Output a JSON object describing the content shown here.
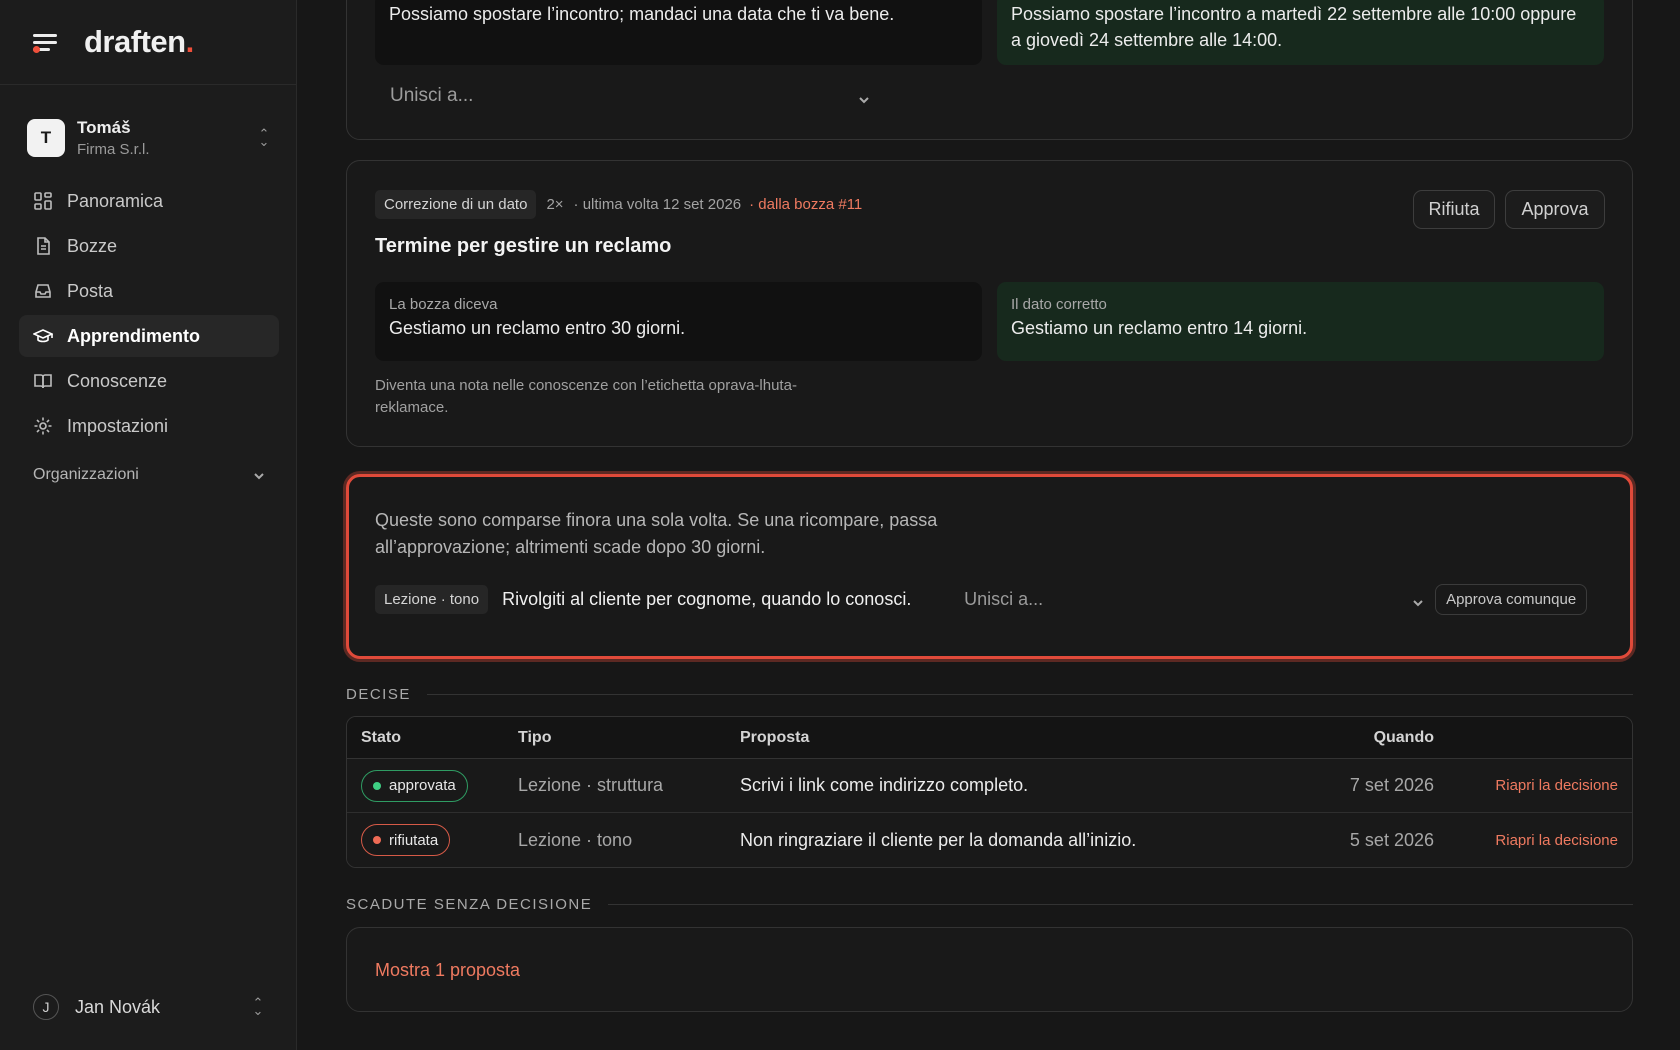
{
  "brand": {
    "name": "draften",
    "dot": "."
  },
  "workspace": {
    "initial": "T",
    "name": "Tomáš",
    "org": "Firma S.r.l."
  },
  "nav": [
    {
      "label": "Panoramica",
      "icon": "dashboard-icon"
    },
    {
      "label": "Bozze",
      "icon": "document-icon"
    },
    {
      "label": "Posta",
      "icon": "inbox-icon"
    },
    {
      "label": "Apprendimento",
      "icon": "graduation-cap-icon",
      "active": true
    },
    {
      "label": "Conoscenze",
      "icon": "book-icon"
    },
    {
      "label": "Impostazioni",
      "icon": "gear-icon"
    }
  ],
  "organizations": {
    "label": "Organizzazioni"
  },
  "user": {
    "initial": "J",
    "name": "Jan Novák"
  },
  "card_top": {
    "old_text": "Possiamo spostare l’incontro; mandaci una data che ti va bene.",
    "new_text": "Possiamo spostare l’incontro a martedì 22 settembre alle 10:00 oppure a giovedì 24 settembre alle 14:00.",
    "merge_placeholder": "Unisci a..."
  },
  "card_correction": {
    "tag": "Correzione di un dato",
    "count": "2×",
    "last": "· ultima volta 12 set 2026",
    "source": "· dalla bozza #11",
    "reject_label": "Rifiuta",
    "approve_label": "Approva",
    "title": "Termine per gestire un reclamo",
    "old_label": "La bozza diceva",
    "old_text": "Gestiamo un reclamo entro 30 giorni.",
    "new_label": "Il dato corretto",
    "new_text": "Gestiamo un reclamo entro 14 giorni.",
    "note": "Diventa una nota nelle conoscenze con l’etichetta oprava-lhuta-reklamace."
  },
  "card_single": {
    "intro": "Queste sono comparse finora una sola volta. Se una ricompare, passa all’approvazione; altrimenti scade dopo 30 giorni.",
    "tag": "Lezione · tono",
    "lesson": "Rivolgiti al cliente per cognome, quando lo conosci.",
    "merge_placeholder": "Unisci a...",
    "approve_anyway": "Approva comunque"
  },
  "decided": {
    "title": "DECISE",
    "headers": {
      "status": "Stato",
      "type": "Tipo",
      "proposal": "Proposta",
      "when": "Quando"
    },
    "rows": [
      {
        "status": "approvata",
        "type": "Lezione · struttura",
        "proposal": "Scrivi i link come indirizzo completo.",
        "when": "7 set 2026",
        "action": "Riapri la decisione"
      },
      {
        "status": "rifiutata",
        "type": "Lezione · tono",
        "proposal": "Non ringraziare il cliente per la domanda all’inizio.",
        "when": "5 set 2026",
        "action": "Riapri la decisione"
      }
    ]
  },
  "expired": {
    "title": "SCADUTE SENZA DECISIONE",
    "show_label": "Mostra 1 proposta"
  },
  "colors": {
    "accent": "#ef4f3a",
    "approved": "#3fcf84",
    "rejected": "#ef6b55",
    "highlight_border": "#e04a3a"
  }
}
